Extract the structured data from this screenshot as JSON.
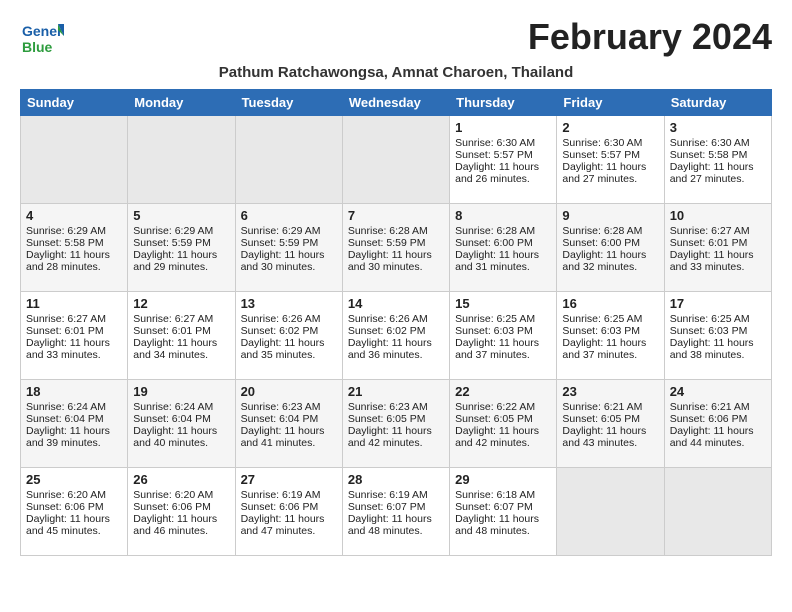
{
  "header": {
    "logo_top": "General",
    "logo_bottom": "Blue",
    "month_title": "February 2024",
    "subtitle": "Pathum Ratchawongsa, Amnat Charoen, Thailand"
  },
  "weekdays": [
    "Sunday",
    "Monday",
    "Tuesday",
    "Wednesday",
    "Thursday",
    "Friday",
    "Saturday"
  ],
  "weeks": [
    [
      {
        "day": "",
        "info": ""
      },
      {
        "day": "",
        "info": ""
      },
      {
        "day": "",
        "info": ""
      },
      {
        "day": "",
        "info": ""
      },
      {
        "day": "1",
        "info": "Sunrise: 6:30 AM\nSunset: 5:57 PM\nDaylight: 11 hours\nand 26 minutes."
      },
      {
        "day": "2",
        "info": "Sunrise: 6:30 AM\nSunset: 5:57 PM\nDaylight: 11 hours\nand 27 minutes."
      },
      {
        "day": "3",
        "info": "Sunrise: 6:30 AM\nSunset: 5:58 PM\nDaylight: 11 hours\nand 27 minutes."
      }
    ],
    [
      {
        "day": "4",
        "info": "Sunrise: 6:29 AM\nSunset: 5:58 PM\nDaylight: 11 hours\nand 28 minutes."
      },
      {
        "day": "5",
        "info": "Sunrise: 6:29 AM\nSunset: 5:59 PM\nDaylight: 11 hours\nand 29 minutes."
      },
      {
        "day": "6",
        "info": "Sunrise: 6:29 AM\nSunset: 5:59 PM\nDaylight: 11 hours\nand 30 minutes."
      },
      {
        "day": "7",
        "info": "Sunrise: 6:28 AM\nSunset: 5:59 PM\nDaylight: 11 hours\nand 30 minutes."
      },
      {
        "day": "8",
        "info": "Sunrise: 6:28 AM\nSunset: 6:00 PM\nDaylight: 11 hours\nand 31 minutes."
      },
      {
        "day": "9",
        "info": "Sunrise: 6:28 AM\nSunset: 6:00 PM\nDaylight: 11 hours\nand 32 minutes."
      },
      {
        "day": "10",
        "info": "Sunrise: 6:27 AM\nSunset: 6:01 PM\nDaylight: 11 hours\nand 33 minutes."
      }
    ],
    [
      {
        "day": "11",
        "info": "Sunrise: 6:27 AM\nSunset: 6:01 PM\nDaylight: 11 hours\nand 33 minutes."
      },
      {
        "day": "12",
        "info": "Sunrise: 6:27 AM\nSunset: 6:01 PM\nDaylight: 11 hours\nand 34 minutes."
      },
      {
        "day": "13",
        "info": "Sunrise: 6:26 AM\nSunset: 6:02 PM\nDaylight: 11 hours\nand 35 minutes."
      },
      {
        "day": "14",
        "info": "Sunrise: 6:26 AM\nSunset: 6:02 PM\nDaylight: 11 hours\nand 36 minutes."
      },
      {
        "day": "15",
        "info": "Sunrise: 6:25 AM\nSunset: 6:03 PM\nDaylight: 11 hours\nand 37 minutes."
      },
      {
        "day": "16",
        "info": "Sunrise: 6:25 AM\nSunset: 6:03 PM\nDaylight: 11 hours\nand 37 minutes."
      },
      {
        "day": "17",
        "info": "Sunrise: 6:25 AM\nSunset: 6:03 PM\nDaylight: 11 hours\nand 38 minutes."
      }
    ],
    [
      {
        "day": "18",
        "info": "Sunrise: 6:24 AM\nSunset: 6:04 PM\nDaylight: 11 hours\nand 39 minutes."
      },
      {
        "day": "19",
        "info": "Sunrise: 6:24 AM\nSunset: 6:04 PM\nDaylight: 11 hours\nand 40 minutes."
      },
      {
        "day": "20",
        "info": "Sunrise: 6:23 AM\nSunset: 6:04 PM\nDaylight: 11 hours\nand 41 minutes."
      },
      {
        "day": "21",
        "info": "Sunrise: 6:23 AM\nSunset: 6:05 PM\nDaylight: 11 hours\nand 42 minutes."
      },
      {
        "day": "22",
        "info": "Sunrise: 6:22 AM\nSunset: 6:05 PM\nDaylight: 11 hours\nand 42 minutes."
      },
      {
        "day": "23",
        "info": "Sunrise: 6:21 AM\nSunset: 6:05 PM\nDaylight: 11 hours\nand 43 minutes."
      },
      {
        "day": "24",
        "info": "Sunrise: 6:21 AM\nSunset: 6:06 PM\nDaylight: 11 hours\nand 44 minutes."
      }
    ],
    [
      {
        "day": "25",
        "info": "Sunrise: 6:20 AM\nSunset: 6:06 PM\nDaylight: 11 hours\nand 45 minutes."
      },
      {
        "day": "26",
        "info": "Sunrise: 6:20 AM\nSunset: 6:06 PM\nDaylight: 11 hours\nand 46 minutes."
      },
      {
        "day": "27",
        "info": "Sunrise: 6:19 AM\nSunset: 6:06 PM\nDaylight: 11 hours\nand 47 minutes."
      },
      {
        "day": "28",
        "info": "Sunrise: 6:19 AM\nSunset: 6:07 PM\nDaylight: 11 hours\nand 48 minutes."
      },
      {
        "day": "29",
        "info": "Sunrise: 6:18 AM\nSunset: 6:07 PM\nDaylight: 11 hours\nand 48 minutes."
      },
      {
        "day": "",
        "info": ""
      },
      {
        "day": "",
        "info": ""
      }
    ]
  ]
}
